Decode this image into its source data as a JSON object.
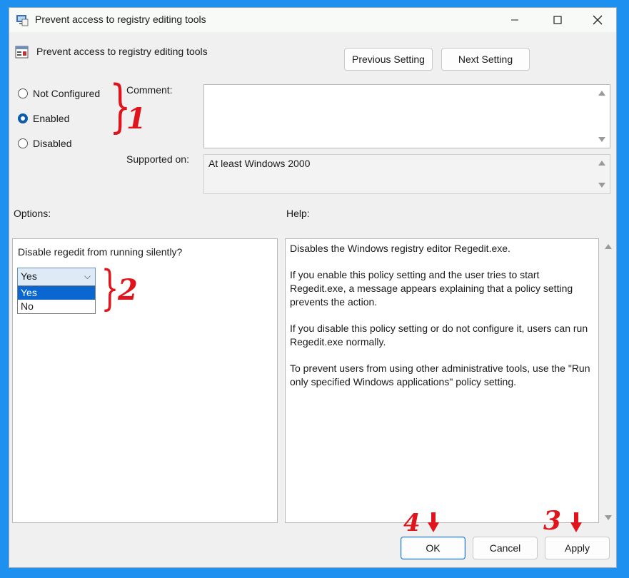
{
  "window": {
    "title": "Prevent access to registry editing tools",
    "controls": [
      "minimize",
      "maximize",
      "close"
    ]
  },
  "header": {
    "policy_name": "Prevent access to registry editing tools",
    "previous_label": "Previous Setting",
    "next_label": "Next Setting"
  },
  "state": {
    "options": [
      {
        "label": "Not Configured",
        "selected": false
      },
      {
        "label": "Enabled",
        "selected": true
      },
      {
        "label": "Disabled",
        "selected": false
      }
    ]
  },
  "comment": {
    "label": "Comment:",
    "value": ""
  },
  "supported": {
    "label": "Supported on:",
    "value": "At least Windows 2000"
  },
  "options_panel": {
    "label": "Options:",
    "question": "Disable regedit from running silently?",
    "selected": "Yes",
    "choices": [
      "Yes",
      "No"
    ]
  },
  "help_panel": {
    "label": "Help:",
    "paragraphs": [
      "Disables the Windows registry editor Regedit.exe.",
      "If you enable this policy setting and the user tries to start Regedit.exe, a message appears explaining that a policy setting prevents the action.",
      "If you disable this policy setting or do not configure it, users can run Regedit.exe normally.",
      "To prevent users from using other administrative tools, use the \"Run only specified Windows applications\" policy setting."
    ]
  },
  "footer": {
    "ok_label": "OK",
    "cancel_label": "Cancel",
    "apply_label": "Apply"
  },
  "annotations": {
    "n1": "1",
    "n2": "2",
    "n3": "3",
    "n4": "4"
  },
  "colors": {
    "accent": "#0a66d0",
    "annotation": "#e0141a",
    "background": "#1e90f0"
  }
}
